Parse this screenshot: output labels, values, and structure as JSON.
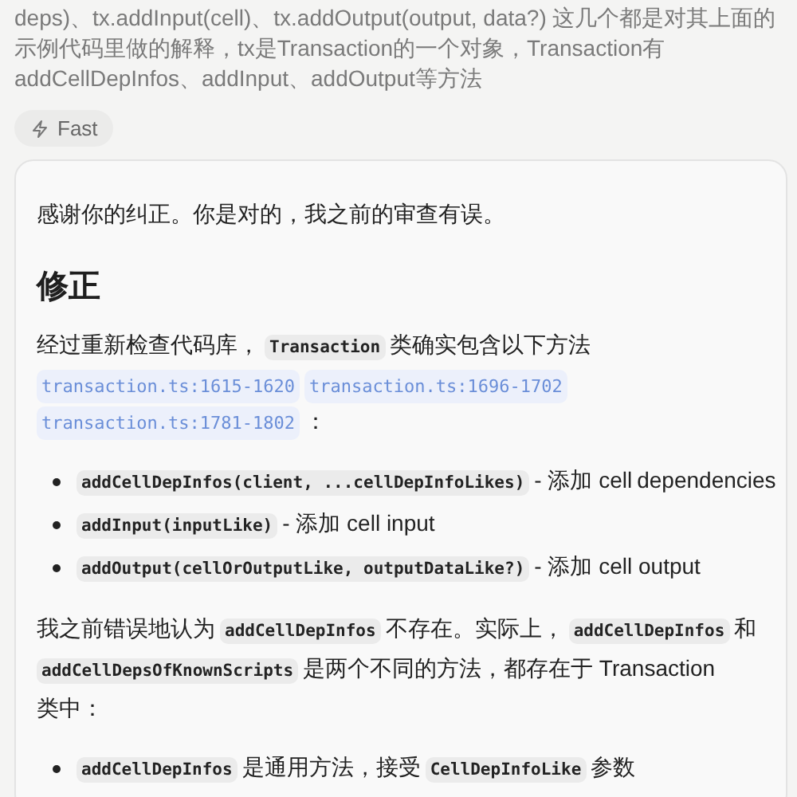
{
  "user_message": {
    "lines": [
      "deps)、tx.addInput(cell)、tx.addOutput(output, data?) 这几个都是对其上面的示例代码里做的解释，tx是Transaction的一个对象，Transaction有addCellDepInfos、addInput、addOutput等方法"
    ]
  },
  "model_badge": {
    "label": "Fast"
  },
  "reply": {
    "blocks": [
      {
        "kind": "para",
        "segments": [
          {
            "kind": "text",
            "text": "感谢你的纠正。你是对的，我之前的审查有误。"
          }
        ]
      },
      {
        "kind": "heading",
        "text": "修正"
      },
      {
        "kind": "para",
        "segments": [
          {
            "kind": "text",
            "text": "经过重新检查代码库，"
          },
          {
            "kind": "code",
            "text": "Transaction"
          },
          {
            "kind": "text",
            "text": "类确实包含以下方法"
          },
          {
            "kind": "link",
            "text": "transaction.ts:1615-1620"
          },
          {
            "kind": "link",
            "text": "transaction.ts:1696-1702"
          },
          {
            "kind": "link",
            "text": "transaction.ts:1781-1802"
          },
          {
            "kind": "text",
            "text": "："
          }
        ]
      },
      {
        "kind": "list",
        "items": [
          [
            {
              "kind": "code",
              "text": "addCellDepInfos(client, ...cellDepInfoLikes)"
            },
            {
              "kind": "text",
              "text": "- 添加 cell"
            },
            {
              "kind": "text",
              "text": "dependencies"
            }
          ],
          [
            {
              "kind": "code",
              "text": "addInput(inputLike)"
            },
            {
              "kind": "text",
              "text": "- 添加 cell input"
            }
          ],
          [
            {
              "kind": "code",
              "text": "addOutput(cellOrOutputLike, outputDataLike?)"
            },
            {
              "kind": "text",
              "text": "- 添加 cell output"
            }
          ]
        ]
      },
      {
        "kind": "para",
        "segments": [
          {
            "kind": "text",
            "text": "我之前错误地认为"
          },
          {
            "kind": "code",
            "text": "addCellDepInfos"
          },
          {
            "kind": "text",
            "text": "不存在。实际上，"
          },
          {
            "kind": "code",
            "text": "addCellDepInfos"
          },
          {
            "kind": "text",
            "text": "和"
          },
          {
            "kind": "code",
            "text": "addCellDepsOfKnownScripts"
          },
          {
            "kind": "text",
            "text": "是两个不同的方法，都存在于 Transaction"
          },
          {
            "kind": "text",
            "text": "类中："
          }
        ]
      },
      {
        "kind": "list",
        "items": [
          [
            {
              "kind": "code",
              "text": "addCellDepInfos"
            },
            {
              "kind": "text",
              "text": "是通用方法，接受"
            },
            {
              "kind": "code",
              "text": "CellDepInfoLike"
            },
            {
              "kind": "text",
              "text": "参数"
            }
          ]
        ]
      }
    ]
  }
}
